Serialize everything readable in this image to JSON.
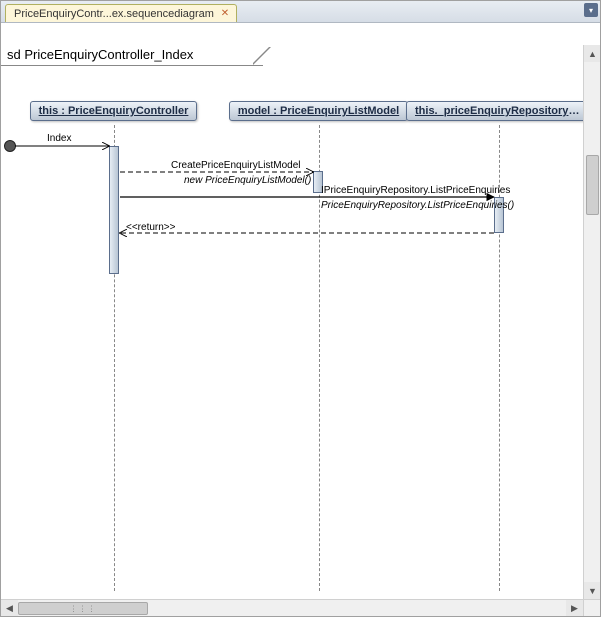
{
  "tabbar": {
    "active_tab": "PriceEnquiryContr...ex.sequencediagram"
  },
  "diagram": {
    "frame_label": "sd PriceEnquiryController_Index",
    "lifelines": {
      "controller": "this : PriceEnquiryController",
      "model": "model : PriceEnquiryListModel",
      "repository": "this._priceEnquiryRepository : T"
    },
    "messages": {
      "found": "Index",
      "create_model": "CreatePriceEnquiryListModel",
      "new_model": "new PriceEnquiryListModel()",
      "iface_list": "IPriceEnquiryRepository.ListPriceEnquiries",
      "impl_list": "PriceEnquiryRepository.ListPriceEnquiries()",
      "return": "<<return>>"
    }
  },
  "chart_data": {
    "type": "sequence-diagram",
    "title": "sd PriceEnquiryController_Index",
    "lifelines": [
      {
        "id": "controller",
        "label": "this : PriceEnquiryController"
      },
      {
        "id": "model",
        "label": "model : PriceEnquiryListModel"
      },
      {
        "id": "repository",
        "label": "this._priceEnquiryRepository : T"
      }
    ],
    "messages": [
      {
        "kind": "found",
        "to": "controller",
        "label": "Index"
      },
      {
        "kind": "self-create",
        "from": "controller",
        "to": "model",
        "label": "CreatePriceEnquiryListModel",
        "sublabel": "new PriceEnquiryListModel()",
        "style": "dashed"
      },
      {
        "kind": "sync",
        "from": "controller",
        "to": "repository",
        "label": "IPriceEnquiryRepository.ListPriceEnquiries",
        "sublabel": "PriceEnquiryRepository.ListPriceEnquiries()"
      },
      {
        "kind": "return",
        "from": "repository",
        "to": "controller",
        "label": "<<return>>",
        "style": "dashed"
      }
    ]
  }
}
